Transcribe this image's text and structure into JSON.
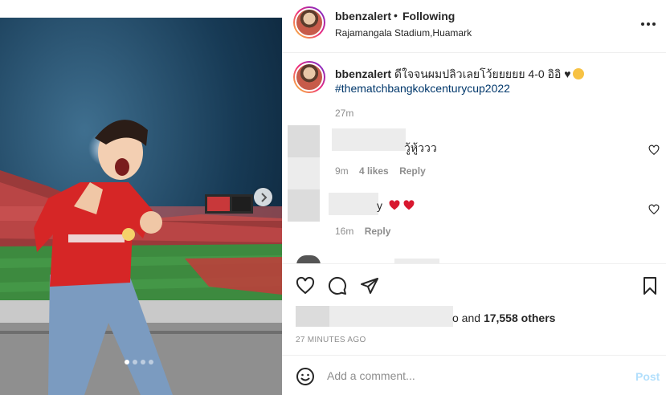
{
  "post": {
    "username": "bbenzalert",
    "separator": "•",
    "follow_status": "Following",
    "location": "Rajamangala Stadium,Huamark",
    "more_icon": "more-horizontal-icon"
  },
  "caption": {
    "username": "bbenzalert",
    "text": "ดีใจจนผมปลิวเลยโว้ยยยยย 4-0 อิอิ ♥",
    "hashtag": "#thematchbangkokcenturycup2022",
    "time": "27m"
  },
  "comments": [
    {
      "text": "วู้หู้ววว",
      "time": "9m",
      "likes": "4 likes",
      "reply": "Reply"
    },
    {
      "text": "y",
      "time": "16m",
      "reply": "Reply"
    }
  ],
  "actions": {
    "like_icon": "heart-icon",
    "comment_icon": "comment-icon",
    "share_icon": "send-icon",
    "save_icon": "bookmark-icon",
    "likes_connector": "o and",
    "likes_count": "17,558 others",
    "posted_ago": "27 MINUTES AGO"
  },
  "add_comment": {
    "placeholder": "Add a comment...",
    "post_label": "Post"
  },
  "carousel": {
    "total": 4,
    "current": 1
  },
  "colors": {
    "link": "#00376b",
    "muted": "#8e8e8e",
    "post_disabled": "#b2dffc",
    "heart_red": "#ed4956"
  }
}
